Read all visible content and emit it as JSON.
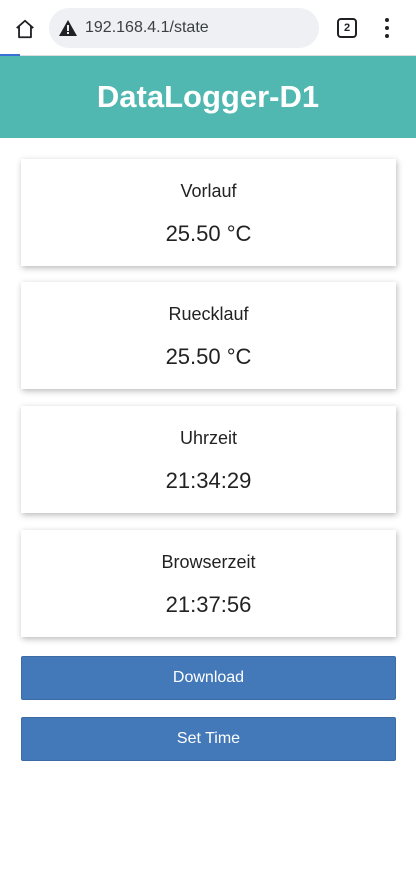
{
  "browser": {
    "url": "192.168.4.1/state",
    "tab_count": "2",
    "icons": [
      "home-icon",
      "warning-icon",
      "tabs-icon",
      "more-vert-icon"
    ]
  },
  "header": {
    "title": "DataLogger-D1",
    "color": "#50b8b1"
  },
  "cards": [
    {
      "label": "Vorlauf",
      "value": "25.50 °C"
    },
    {
      "label": "Ruecklauf",
      "value": "25.50 °C"
    },
    {
      "label": "Uhrzeit",
      "value": "21:34:29"
    },
    {
      "label": "Browserzeit",
      "value": "21:37:56"
    }
  ],
  "buttons": {
    "download": "Download",
    "set_time": "Set Time",
    "color": "#4479b9"
  }
}
